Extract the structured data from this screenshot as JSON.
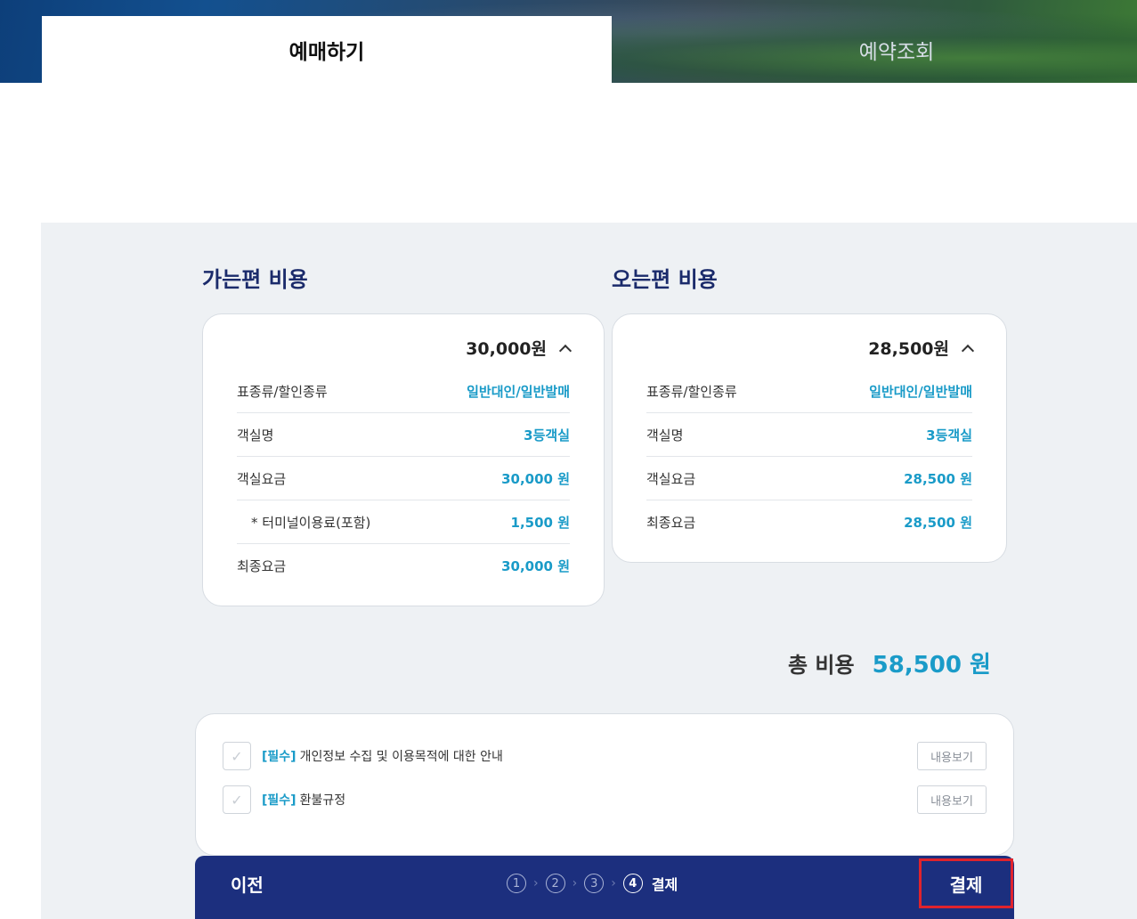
{
  "tabs": {
    "reserve": "예매하기",
    "lookup": "예약조회"
  },
  "outbound": {
    "title": "가는편 비용",
    "total": "30,000원",
    "rows": [
      {
        "label": "표종류/할인종류",
        "value": "일반대인/일반발매"
      },
      {
        "label": "객실명",
        "value": "3등객실"
      },
      {
        "label": "객실요금",
        "value": "30,000 원"
      },
      {
        "label": "* 터미널이용료(포함)",
        "value": "1,500 원"
      },
      {
        "label": "최종요금",
        "value": "30,000 원"
      }
    ]
  },
  "inbound": {
    "title": "오는편 비용",
    "total": "28,500원",
    "rows": [
      {
        "label": "표종류/할인종류",
        "value": "일반대인/일반발매"
      },
      {
        "label": "객실명",
        "value": "3등객실"
      },
      {
        "label": "객실요금",
        "value": "28,500 원"
      },
      {
        "label": "최종요금",
        "value": "28,500 원"
      }
    ]
  },
  "grand_total": {
    "label": "총 비용",
    "amount": "58,500 원"
  },
  "agreements": [
    {
      "tag": "[필수]",
      "text": "개인정보 수집 및 이용목적에 대한 안내",
      "button": "내용보기"
    },
    {
      "tag": "[필수]",
      "text": "환불규정",
      "button": "내용보기"
    }
  ],
  "footer": {
    "prev": "이전",
    "steps": [
      "1",
      "2",
      "3",
      "4"
    ],
    "current_step_label": "결제",
    "pay": "결제"
  },
  "colors": {
    "navy": "#1c2f7e",
    "accent": "#1a9bc8",
    "highlight": "#e0232c"
  },
  "icons": {
    "checkbox": "check-icon",
    "collapse": "chevron-up-icon"
  }
}
